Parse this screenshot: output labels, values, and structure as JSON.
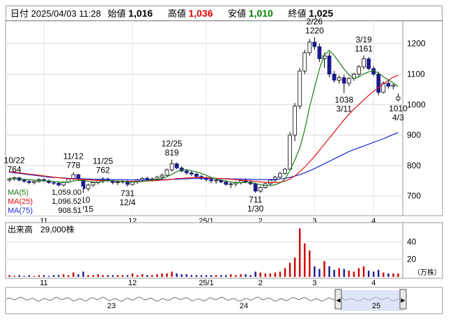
{
  "header": {
    "date_label": "日付",
    "datetime": "2025/04/03 11:28",
    "open_label": "始値",
    "open": "1,016",
    "high_label": "高値",
    "high": "1,036",
    "low_label": "安値",
    "low": "1,010",
    "close_label": "終値",
    "close": "1,025"
  },
  "colors": {
    "up": "#ffffff",
    "down": "#1a1a8c",
    "ma5": "#1a7a1a",
    "ma25": "#e01010",
    "ma75": "#1a2adc",
    "vol_up": "#d00000",
    "vol_down": "#1a1a8c"
  },
  "legend": [
    {
      "label": "MA(5)",
      "value": "1,059.00"
    },
    {
      "label": "MA(25)",
      "value": "1,096.52"
    },
    {
      "label": "MA(75)",
      "value": "908.51"
    }
  ],
  "volume_panel": {
    "label": "出来高",
    "unit_value": "29,000株",
    "unit": "（万株）",
    "ticks": [
      "40",
      "20"
    ]
  },
  "navigator": {
    "labels": [
      "23",
      "24",
      "25"
    ],
    "left_handle": "◀",
    "right_handle": "▶"
  },
  "chart_data": {
    "type": "candlestick",
    "ylim": [
      640,
      1270
    ],
    "y_ticks": [
      700,
      800,
      900,
      1000,
      1100,
      1200
    ],
    "x_ticks": [
      "11",
      "12",
      "25/1",
      "2",
      "3",
      "4"
    ],
    "annotations": [
      {
        "date": "10/22",
        "value": 764
      },
      {
        "date": "11/12",
        "value": 778
      },
      {
        "date": "11/25",
        "value": 762
      },
      {
        "date": "12/25",
        "value": 819
      },
      {
        "date": "2/26",
        "value": 1220
      },
      {
        "date": "3/19",
        "value": 1161
      },
      {
        "date": "11/15",
        "value": 710
      },
      {
        "date": "12/4",
        "value": 731
      },
      {
        "date": "1/30",
        "value": 711
      },
      {
        "date": "3/11",
        "value": 1038
      },
      {
        "date": "4/3",
        "value": 1010
      }
    ],
    "candles": [
      [
        752,
        760,
        746,
        756
      ],
      [
        756,
        764,
        750,
        760
      ],
      [
        760,
        762,
        748,
        752
      ],
      [
        752,
        756,
        744,
        748
      ],
      [
        748,
        752,
        738,
        744
      ],
      [
        744,
        750,
        738,
        748
      ],
      [
        748,
        758,
        744,
        754
      ],
      [
        754,
        758,
        746,
        750
      ],
      [
        750,
        754,
        740,
        744
      ],
      [
        744,
        748,
        736,
        742
      ],
      [
        742,
        746,
        730,
        736
      ],
      [
        736,
        748,
        732,
        746
      ],
      [
        746,
        760,
        742,
        756
      ],
      [
        756,
        778,
        752,
        770
      ],
      [
        770,
        772,
        750,
        756
      ],
      [
        756,
        758,
        710,
        724
      ],
      [
        724,
        740,
        716,
        736
      ],
      [
        736,
        748,
        730,
        744
      ],
      [
        744,
        756,
        738,
        752
      ],
      [
        752,
        762,
        742,
        756
      ],
      [
        756,
        760,
        746,
        750
      ],
      [
        750,
        754,
        738,
        744
      ],
      [
        744,
        750,
        736,
        746
      ],
      [
        746,
        752,
        740,
        748
      ],
      [
        748,
        752,
        731,
        738
      ],
      [
        738,
        748,
        734,
        746
      ],
      [
        746,
        756,
        740,
        752
      ],
      [
        752,
        762,
        746,
        758
      ],
      [
        758,
        764,
        748,
        754
      ],
      [
        754,
        760,
        748,
        756
      ],
      [
        756,
        766,
        750,
        762
      ],
      [
        762,
        774,
        756,
        768
      ],
      [
        768,
        790,
        764,
        786
      ],
      [
        786,
        819,
        780,
        806
      ],
      [
        806,
        810,
        788,
        792
      ],
      [
        792,
        798,
        778,
        782
      ],
      [
        782,
        788,
        770,
        776
      ],
      [
        776,
        782,
        766,
        772
      ],
      [
        772,
        776,
        760,
        764
      ],
      [
        764,
        770,
        752,
        758
      ],
      [
        758,
        764,
        748,
        754
      ],
      [
        754,
        760,
        742,
        750
      ],
      [
        750,
        756,
        740,
        752
      ],
      [
        752,
        758,
        742,
        746
      ],
      [
        746,
        752,
        734,
        738
      ],
      [
        738,
        744,
        726,
        740
      ],
      [
        740,
        748,
        732,
        744
      ],
      [
        744,
        756,
        738,
        750
      ],
      [
        750,
        758,
        742,
        746
      ],
      [
        746,
        752,
        736,
        740
      ],
      [
        740,
        744,
        711,
        716
      ],
      [
        716,
        732,
        711,
        728
      ],
      [
        728,
        744,
        724,
        740
      ],
      [
        740,
        756,
        734,
        752
      ],
      [
        752,
        766,
        746,
        762
      ],
      [
        762,
        780,
        756,
        774
      ],
      [
        774,
        792,
        770,
        788
      ],
      [
        788,
        910,
        784,
        900
      ],
      [
        900,
        1005,
        880,
        995
      ],
      [
        995,
        1120,
        985,
        1110
      ],
      [
        1110,
        1180,
        1100,
        1170
      ],
      [
        1170,
        1215,
        1160,
        1205
      ],
      [
        1205,
        1220,
        1180,
        1190
      ],
      [
        1190,
        1200,
        1140,
        1150
      ],
      [
        1150,
        1170,
        1120,
        1160
      ],
      [
        1160,
        1172,
        1090,
        1100
      ],
      [
        1100,
        1110,
        1072,
        1080
      ],
      [
        1080,
        1096,
        1068,
        1088
      ],
      [
        1088,
        1098,
        1038,
        1070
      ],
      [
        1070,
        1090,
        1060,
        1086
      ],
      [
        1086,
        1104,
        1078,
        1100
      ],
      [
        1100,
        1130,
        1092,
        1124
      ],
      [
        1124,
        1161,
        1116,
        1150
      ],
      [
        1150,
        1156,
        1112,
        1118
      ],
      [
        1118,
        1126,
        1094,
        1100
      ],
      [
        1100,
        1108,
        1030,
        1040
      ],
      [
        1040,
        1076,
        1036,
        1070
      ],
      [
        1070,
        1080,
        1052,
        1060
      ],
      [
        1060,
        1068,
        1050,
        1064
      ],
      [
        1016,
        1036,
        1010,
        1025
      ]
    ],
    "ma5": [
      758,
      757,
      756,
      755,
      754,
      752,
      751,
      750,
      749,
      748,
      746,
      745,
      746,
      749,
      751,
      751,
      748,
      746,
      745,
      748,
      751,
      750,
      749,
      748,
      747,
      746,
      746,
      748,
      750,
      752,
      754,
      758,
      763,
      771,
      780,
      786,
      786,
      783,
      779,
      774,
      768,
      761,
      756,
      752,
      749,
      746,
      744,
      743,
      745,
      745,
      741,
      737,
      734,
      734,
      737,
      743,
      755,
      784,
      818,
      858,
      917,
      992,
      1055,
      1117,
      1163,
      1178,
      1161,
      1139,
      1116,
      1098,
      1085,
      1091,
      1101,
      1107,
      1112,
      1103,
      1091,
      1081,
      1071,
      1059
    ],
    "ma25": [
      780,
      778,
      776,
      774,
      772,
      770,
      768,
      766,
      764,
      762,
      760,
      758,
      757,
      756,
      755,
      754,
      753,
      752,
      751,
      750,
      750,
      749,
      749,
      748,
      748,
      748,
      748,
      748,
      749,
      750,
      751,
      752,
      753,
      755,
      757,
      758,
      759,
      760,
      760,
      760,
      760,
      759,
      758,
      757,
      756,
      755,
      754,
      752,
      751,
      750,
      748,
      746,
      745,
      744,
      744,
      745,
      749,
      756,
      766,
      780,
      795,
      812,
      830,
      850,
      870,
      890,
      910,
      930,
      950,
      968,
      985,
      1000,
      1015,
      1030,
      1044,
      1056,
      1068,
      1080,
      1090,
      1096
    ],
    "ma75": [
      778,
      776,
      774,
      772,
      770,
      768,
      766,
      764,
      762,
      761,
      760,
      759,
      758,
      757,
      757,
      756,
      756,
      755,
      755,
      755,
      754,
      754,
      754,
      754,
      753,
      753,
      753,
      753,
      753,
      753,
      753,
      754,
      754,
      755,
      755,
      756,
      756,
      757,
      757,
      757,
      757,
      757,
      757,
      757,
      757,
      756,
      756,
      756,
      755,
      755,
      754,
      754,
      754,
      754,
      755,
      756,
      758,
      761,
      765,
      770,
      776,
      783,
      790,
      798,
      806,
      814,
      822,
      830,
      838,
      846,
      852,
      858,
      864,
      870,
      876,
      882,
      888,
      895,
      902,
      908
    ],
    "volume": [
      2,
      1,
      2,
      1,
      2,
      1,
      2,
      2,
      1,
      2,
      2,
      3,
      2,
      5,
      3,
      6,
      2,
      2,
      3,
      2,
      2,
      2,
      2,
      2,
      2,
      4,
      2,
      3,
      2,
      2,
      3,
      4,
      4,
      6,
      4,
      3,
      3,
      2,
      2,
      2,
      2,
      2,
      2,
      2,
      2,
      3,
      2,
      3,
      3,
      2,
      6,
      5,
      4,
      4,
      5,
      6,
      10,
      16,
      22,
      55,
      38,
      30,
      12,
      9,
      18,
      12,
      8,
      10,
      9,
      7,
      6,
      10,
      12,
      7,
      6,
      8,
      5,
      4,
      4,
      4
    ]
  }
}
